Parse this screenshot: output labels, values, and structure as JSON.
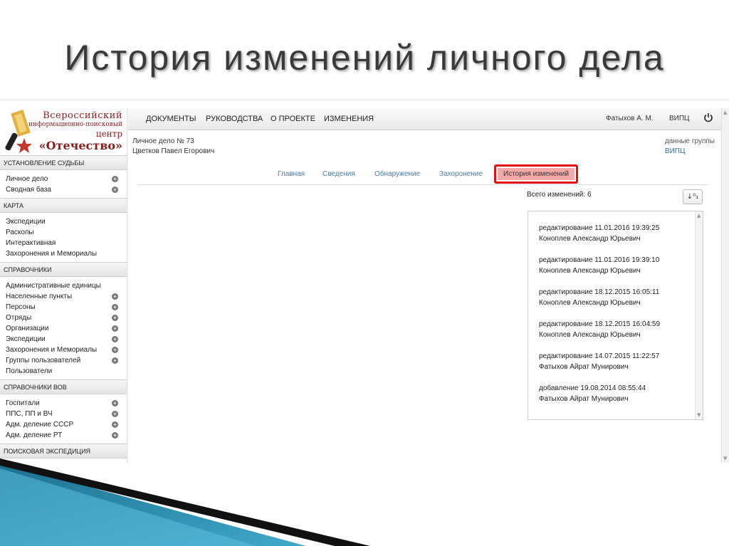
{
  "slide": {
    "title": "История изменений личного дела"
  },
  "logo": {
    "line1": "Всероссийский",
    "line2": "информационно-поисковый",
    "line3": "центр",
    "line4": "«Отечество»"
  },
  "sidebar": {
    "sections": [
      {
        "title": "УСТАНОВЛЕНИЕ СУДЬБЫ",
        "items": [
          {
            "label": "Личное дело",
            "plus": true
          },
          {
            "label": "Сводная база",
            "plus": true
          }
        ]
      },
      {
        "title": "КАРТА",
        "items": [
          {
            "label": "Экспедиции",
            "plus": false
          },
          {
            "label": "Раскопы",
            "plus": false
          },
          {
            "label": "Интерактивная",
            "plus": false
          },
          {
            "label": "Захоронения и Мемориалы",
            "plus": false
          }
        ]
      },
      {
        "title": "СПРАВОЧНИКИ",
        "items": [
          {
            "label": "Административные единицы",
            "plus": false
          },
          {
            "label": "Населенные пункты",
            "plus": true
          },
          {
            "label": "Персоны",
            "plus": true
          },
          {
            "label": "Отряды",
            "plus": true
          },
          {
            "label": "Организации",
            "plus": true
          },
          {
            "label": "Экспедиции",
            "plus": true
          },
          {
            "label": "Захоронения и Мемориалы",
            "plus": true
          },
          {
            "label": "Группы пользователей",
            "plus": true
          },
          {
            "label": "Пользователи",
            "plus": false
          }
        ]
      },
      {
        "title": "СПРАВОЧНИКИ ВОВ",
        "items": [
          {
            "label": "Госпитали",
            "plus": true
          },
          {
            "label": "ППС, ПП и ВЧ",
            "plus": true
          },
          {
            "label": "Адм. деление СССР",
            "plus": true
          },
          {
            "label": "Адм. деление РТ",
            "plus": true
          }
        ]
      },
      {
        "title": "ПОИСКОВАЯ ЭКСПЕДИЦИЯ",
        "items": []
      }
    ]
  },
  "topnav": {
    "items": [
      "ДОКУМЕНТЫ",
      "РУКОВОДСТВА",
      "О ПРОЕКТЕ",
      "ИЗМЕНЕНИЯ"
    ],
    "user": "Фатыхов А. М.",
    "org": "ВИПЦ"
  },
  "case": {
    "number": "Личное дело № 73",
    "name": "Цветков Павел Егорович",
    "group_label": "данные группы",
    "group_value": "ВИПЦ"
  },
  "tabs": {
    "items": [
      "Главная",
      "Сведения",
      "Обнаружение",
      "Захоронение"
    ],
    "active": "История изменений"
  },
  "history": {
    "total": "Всего изменений: 6",
    "sort_label": "↓⁰₁",
    "entries": [
      {
        "action": "редактирование  11.01.2016 19:39:25",
        "user": "Коноплев Александр Юрьевич"
      },
      {
        "action": "редактирование  11.01.2016 19:39:10",
        "user": "Коноплев Александр Юрьевич"
      },
      {
        "action": "редактирование  18.12.2015 16:05:11",
        "user": "Коноплев Александр Юрьевич"
      },
      {
        "action": "редактирование  18.12.2015 16:04:59",
        "user": "Коноплев Александр Юрьевич"
      },
      {
        "action": "редактирование  14.07.2015 11:22:57",
        "user": "Фатыхов Айрат Мунирович"
      },
      {
        "action": "добавление  19.08.2014 08:55:44",
        "user": "Фатыхов Айрат Мунирович"
      }
    ]
  },
  "colors": {
    "accent_red": "#e01010",
    "active_tab_fill": "#f4a9a9",
    "link_blue": "#4a7ab0",
    "logo_red": "#8a1d1d"
  }
}
